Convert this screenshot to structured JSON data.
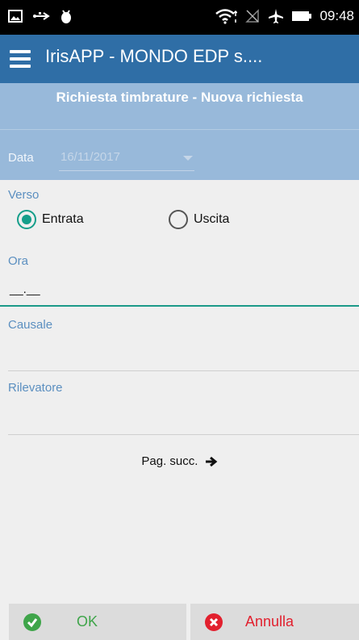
{
  "status_bar": {
    "time": "09:48",
    "icons": [
      "image-icon",
      "usb-icon",
      "android-debug-icon",
      "wifi-icon",
      "no-signal-icon",
      "airplane-icon",
      "battery-icon"
    ]
  },
  "app_bar": {
    "title": "IrisAPP - MONDO EDP s....",
    "menu_icon": "hamburger-menu-icon"
  },
  "header": {
    "title": "Richiesta timbrature - Nuova richiesta"
  },
  "form": {
    "data_label": "Data",
    "data_value": "16/11/2017",
    "verso_label": "Verso",
    "verso_options": [
      "Entrata",
      "Uscita"
    ],
    "verso_selected": "Entrata",
    "ora_label": "Ora",
    "ora_value": "__.__",
    "causale_label": "Causale",
    "rilevatore_label": "Rilevatore",
    "next_label": "Pag. succ."
  },
  "footer": {
    "ok_label": "OK",
    "cancel_label": "Annulla"
  },
  "colors": {
    "app_bar": "#2f6ea6",
    "header": "#98b9da",
    "accent": "#159e8a",
    "ok_green": "#3fa54a",
    "cancel_red": "#e2202e"
  }
}
